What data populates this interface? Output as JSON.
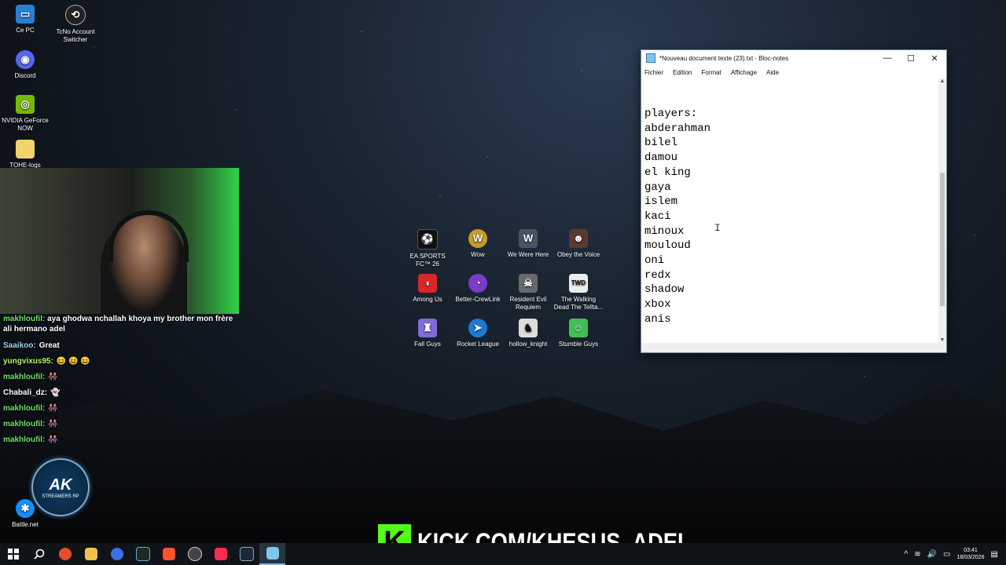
{
  "desktop_left_icons": [
    {
      "label": "Ce PC",
      "icon": "computer-icon",
      "color": "#2a7fd4"
    },
    {
      "label": "TcNo Account Switcher",
      "icon": "account-switcher-icon",
      "color": "#222222"
    },
    {
      "label": "Discord",
      "icon": "discord-icon",
      "color": "#5865f2"
    },
    {
      "label": "NVIDIA GeForce NOW",
      "icon": "nvidia-icon",
      "color": "#76b900"
    },
    {
      "label": "TOHE-logs",
      "icon": "folder-icon",
      "color": "#f2d36b"
    },
    {
      "label": "Battle.net",
      "icon": "battlenet-icon",
      "color": "#148eff"
    }
  ],
  "desktop_games": [
    {
      "label": "EA SPORTS FC™ 26",
      "icon": "ea-fc-icon",
      "color": "#111111"
    },
    {
      "label": "Wow",
      "icon": "wow-icon",
      "color": "#c79b2a"
    },
    {
      "label": "We Were Here",
      "icon": "we-were-here-icon",
      "color": "#4a5563"
    },
    {
      "label": "Obey the Voice",
      "icon": "obey-voice-icon",
      "color": "#5a3a30"
    },
    {
      "label": "Among Us",
      "icon": "among-us-icon",
      "color": "#d62828"
    },
    {
      "label": "Better-CrewLink",
      "icon": "crewlink-icon",
      "color": "#7a3cc9"
    },
    {
      "label": "Resident Evil Requiem",
      "icon": "resident-evil-icon",
      "color": "#6a6a6a"
    },
    {
      "label": "The Walking Dead The Tellta...",
      "icon": "walking-dead-icon",
      "color": "#eeeeee"
    },
    {
      "label": "Fall Guys",
      "icon": "fall-guys-icon",
      "color": "#7f6bd9"
    },
    {
      "label": "Rocket League",
      "icon": "rocket-league-icon",
      "color": "#1d7ad6"
    },
    {
      "label": "hollow_knight",
      "icon": "hollow-knight-icon",
      "color": "#dddddd"
    },
    {
      "label": "Stumble Guys",
      "icon": "stumble-guys-icon",
      "color": "#3fbf54"
    }
  ],
  "chat": [
    {
      "user": "makhloufil:",
      "text": "aya ghodwa nchallah khoya my brother mon frère ali hermano adel"
    },
    {
      "user": "Saaikoo:",
      "text": "Great"
    },
    {
      "user": "yungvixus95:",
      "text": "😆 😆 😆"
    },
    {
      "user": "makhloufil:",
      "text": "👭"
    },
    {
      "user": "Chabali_dz:",
      "text": "👻"
    },
    {
      "user": "makhloufil:",
      "text": "👭"
    },
    {
      "user": "makhloufil:",
      "text": "👭"
    },
    {
      "user": "makhloufil:",
      "text": "👭"
    }
  ],
  "overlay_logo": {
    "title": "AK",
    "subtitle": "STREAMERS RP"
  },
  "notepad": {
    "title": "*Nouveau document texte (23).txt - Bloc-notes",
    "menu": [
      "Fichier",
      "Edition",
      "Format",
      "Affichage",
      "Aide"
    ],
    "content": "players:\nabderahman\nbilel\ndamou\nel king\ngaya\nislem\nkaci\nminoux\nmouloud\noni\nredx\nshadow\nxbox\nanis"
  },
  "kick": {
    "url": "KICK.COM/KHESUS_ADEL",
    "brand_color": "#53fc18"
  },
  "taskbar": {
    "apps": [
      {
        "icon": "file-explorer-icon",
        "color": "#f0c24a"
      },
      {
        "icon": "chrome-icon",
        "color": "#e44d2b"
      },
      {
        "icon": "app-blue-icon",
        "color": "#3a6fe6"
      },
      {
        "icon": "terminal-icon",
        "color": "#1f2a1f"
      },
      {
        "icon": "brave-icon",
        "color": "#fb542b"
      },
      {
        "icon": "obs-icon",
        "color": "#444444"
      },
      {
        "icon": "tiktok-icon",
        "color": "#fe2c55"
      },
      {
        "icon": "steam-icon",
        "color": "#1b2838"
      },
      {
        "icon": "notepad-icon",
        "color": "#7fc7e9"
      }
    ],
    "time": "03:41",
    "date": "18/03/2026"
  }
}
